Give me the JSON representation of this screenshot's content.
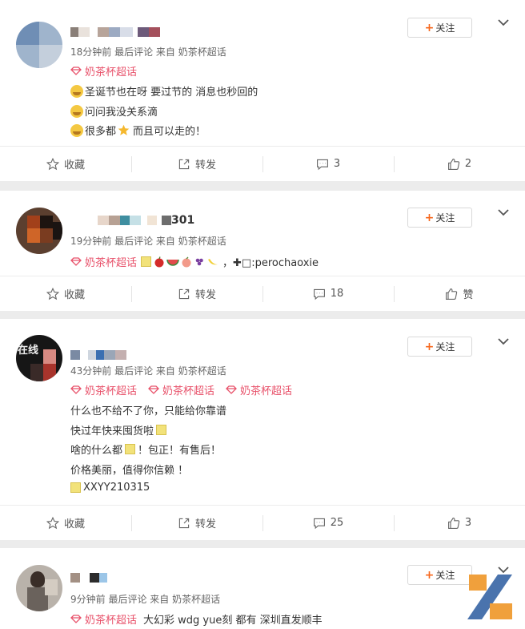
{
  "actions": {
    "collect": "收藏",
    "repost": "转发",
    "like_text": "赞"
  },
  "follow_label": "关注",
  "posts": [
    {
      "name": "",
      "meta": "18分钟前 最后评论 来自 奶茶杯超话",
      "tag": "奶茶杯超话",
      "lines": [
        "圣诞节也在呀 要过节的 消息也秒回的",
        "问问我没关系滴",
        "很多都",
        "而且可以走的！"
      ],
      "comments": "3",
      "likes": "2"
    },
    {
      "name_suffix": "301",
      "meta": "19分钟前 最后评论 来自 奶茶杯超话",
      "tag": "奶茶杯超话",
      "contact": "，✚□:perochaoxie",
      "comments": "18",
      "likes": "赞"
    },
    {
      "meta": "43分钟前 最后评论 来自 奶茶杯超话",
      "avatar_text": "在线",
      "tags": [
        "奶茶杯超话",
        "奶茶杯超话",
        "奶茶杯超话"
      ],
      "lines": [
        "什么也不给不了你，只能给你靠谱",
        "快过年快来囤货啦",
        "啥的什么都",
        "！包正！有售后！",
        "价格美丽，值得你信赖 ！",
        "XXYY210315"
      ],
      "comments": "25",
      "likes": "3"
    },
    {
      "meta": "9分钟前 最后评论 来自 奶茶杯超话",
      "tag": "奶茶杯超话",
      "text": "大幻彩 wdg yue刻 都有 深圳直发顺丰"
    }
  ]
}
